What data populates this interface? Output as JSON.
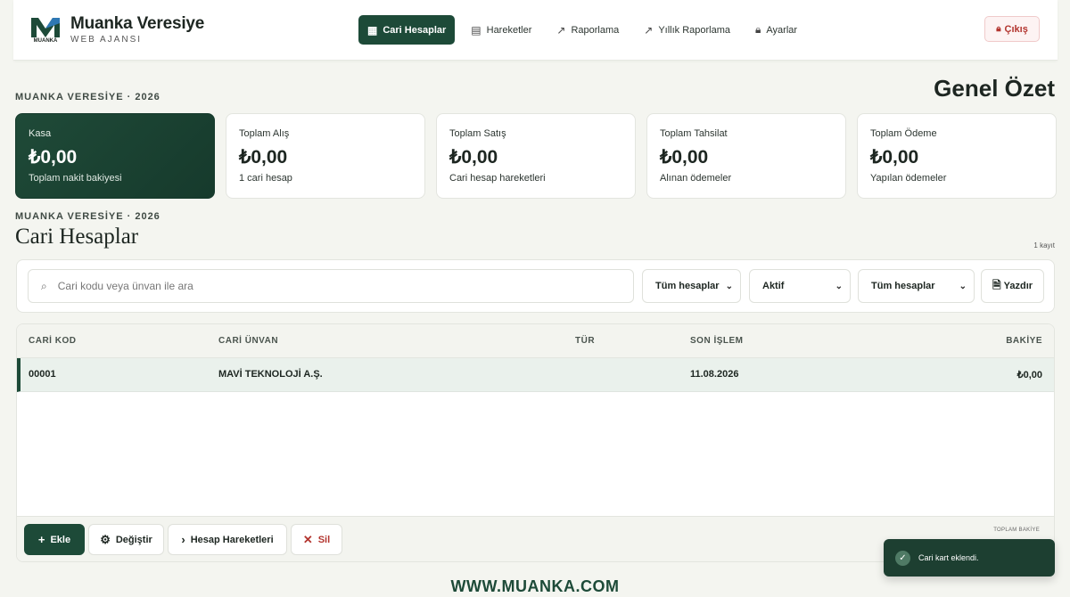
{
  "brand": {
    "name": "Muanka Veresiye",
    "sub": "WEB AJANSI",
    "mark_text": "MUANKA"
  },
  "nav": {
    "items": [
      {
        "label": "Cari Hesaplar",
        "icon": "building-icon",
        "active": true
      },
      {
        "label": "Hareketler",
        "icon": "document-icon",
        "active": false
      },
      {
        "label": "Raporlama",
        "icon": "trend-icon",
        "active": false
      },
      {
        "label": "Yıllık Raporlama",
        "icon": "trend-icon",
        "active": false
      },
      {
        "label": "Ayarlar",
        "icon": "lock-icon",
        "active": false
      }
    ],
    "logout_label": "Çıkış"
  },
  "summary": {
    "kicker": "MUANKA VERESİYE · 2026",
    "title": "Genel Özet",
    "cards": [
      {
        "label": "Kasa",
        "value": "₺0,00",
        "sub": "Toplam nakit bakiyesi"
      },
      {
        "label": "Toplam Alış",
        "value": "₺0,00",
        "sub": "1 cari hesap"
      },
      {
        "label": "Toplam Satış",
        "value": "₺0,00",
        "sub": "Cari hesap hareketleri"
      },
      {
        "label": "Toplam Tahsilat",
        "value": "₺0,00",
        "sub": "Alınan ödemeler"
      },
      {
        "label": "Toplam Ödeme",
        "value": "₺0,00",
        "sub": "Yapılan ödemeler"
      }
    ]
  },
  "accounts": {
    "kicker": "MUANKA VERESİYE · 2026",
    "title": "Cari Hesaplar",
    "record_count": "1 kayıt",
    "search_placeholder": "Cari kodu veya ünvan ile ara",
    "filters": [
      "Tüm hesaplar",
      "Aktif",
      "Tüm hesaplar"
    ],
    "print_label": "Yazdır",
    "columns": [
      "CARİ KOD",
      "CARİ ÜNVAN",
      "TÜR",
      "SON İŞLEM",
      "BAKİYE"
    ],
    "rows": [
      {
        "code": "00001",
        "title": "MAVİ TEKNOLOJİ A.Ş.",
        "type": "",
        "last": "11.08.2026",
        "balance": "₺0,00"
      }
    ],
    "actions": {
      "add": "Ekle",
      "edit": "Değiştir",
      "movements": "Hesap Hareketleri",
      "delete": "Sil"
    },
    "total_label": "TOPLAM BAKİYE"
  },
  "toast": {
    "message": "Cari kart eklendi."
  },
  "footer": {
    "url": "WWW.MUANKA.COM"
  },
  "colors": {
    "primary": "#1d4a38",
    "danger": "#b3352f",
    "background": "#f4f5f0"
  }
}
